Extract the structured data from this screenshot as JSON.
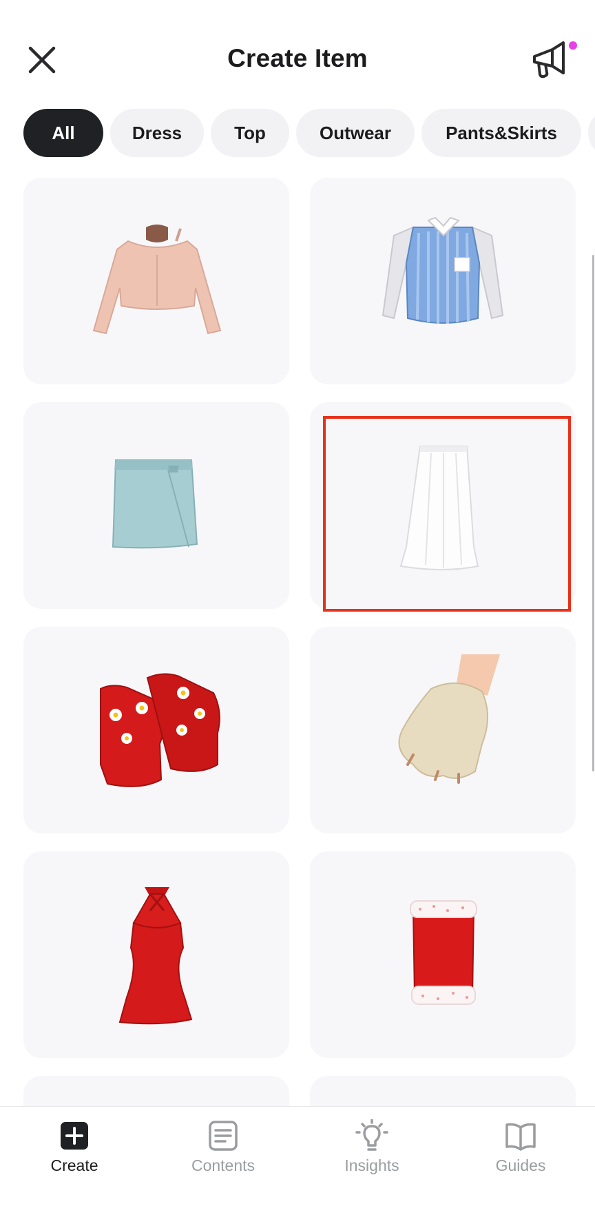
{
  "header": {
    "title": "Create Item",
    "close_icon": "close-icon",
    "announce_icon": "megaphone-icon",
    "notification_dot_color": "#e640e6"
  },
  "categories": {
    "items": [
      "All",
      "Dress",
      "Top",
      "Outwear",
      "Pants&Skirts"
    ],
    "selected": "All"
  },
  "items": [
    {
      "name": "Pink off-shoulder crop top"
    },
    {
      "name": "Blue striped shirt with white sleeves"
    },
    {
      "name": "Light blue wrap mini skirt"
    },
    {
      "name": "White midi skirt",
      "highlighted": true
    },
    {
      "name": "Red daisy platform sandals"
    },
    {
      "name": "Beige paw gloves"
    },
    {
      "name": "Red halter dress"
    },
    {
      "name": "Red strapless dress with white fur trim"
    }
  ],
  "bottom_nav": {
    "items": [
      {
        "label": "Create",
        "icon": "plus-square-icon",
        "active": true
      },
      {
        "label": "Contents",
        "icon": "document-icon",
        "active": false
      },
      {
        "label": "Insights",
        "icon": "lightbulb-icon",
        "active": false
      },
      {
        "label": "Guides",
        "icon": "book-icon",
        "active": false
      }
    ]
  },
  "colors": {
    "highlight": "#e8311a",
    "chip_active": "#1f2124",
    "chip_inactive": "#f2f2f4",
    "card_background": "#f7f7f9"
  }
}
